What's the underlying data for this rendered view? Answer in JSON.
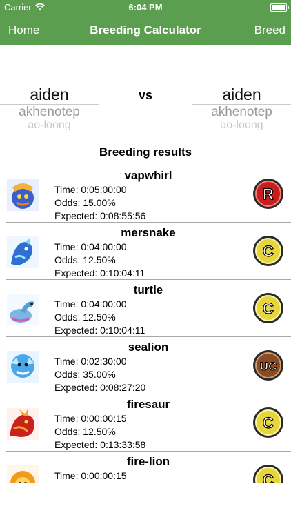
{
  "status": {
    "carrier": "Carrier",
    "time": "6:04 PM"
  },
  "nav": {
    "left": "Home",
    "title": "Breeding Calculator",
    "right": "Breed"
  },
  "picker_left": {
    "selected": "aiden",
    "next": "akhenotep",
    "far": "ao-loong"
  },
  "picker_right": {
    "selected": "aiden",
    "next": "akhenotep",
    "far": "ao-loong"
  },
  "vs": "vs",
  "results": {
    "title": "Breeding results",
    "items": [
      {
        "name": "vapwhirl",
        "time": "Time: 0:05:00:00",
        "odds": "Odds: 15.00%",
        "expected": "Expected: 0:08:55:56",
        "rarity": "R"
      },
      {
        "name": "mersnake",
        "time": "Time: 0:04:00:00",
        "odds": "Odds: 12.50%",
        "expected": "Expected: 0:10:04:11",
        "rarity": "C"
      },
      {
        "name": "turtle",
        "time": "Time: 0:04:00:00",
        "odds": "Odds: 12.50%",
        "expected": "Expected: 0:10:04:11",
        "rarity": "C"
      },
      {
        "name": "sealion",
        "time": "Time: 0:02:30:00",
        "odds": "Odds: 35.00%",
        "expected": "Expected: 0:08:27:20",
        "rarity": "UC"
      },
      {
        "name": "firesaur",
        "time": "Time: 0:00:00:15",
        "odds": "Odds: 12.50%",
        "expected": "Expected: 0:13:33:58",
        "rarity": "C"
      },
      {
        "name": "fire-lion",
        "time": "Time: 0:00:00:15",
        "odds": "",
        "expected": "",
        "rarity": "C"
      }
    ]
  },
  "colors": {
    "nav": "#5b9e4f",
    "badge_r": "#c81e1e",
    "badge_c": "#e7d63b",
    "badge_uc": "#8a4a24"
  }
}
